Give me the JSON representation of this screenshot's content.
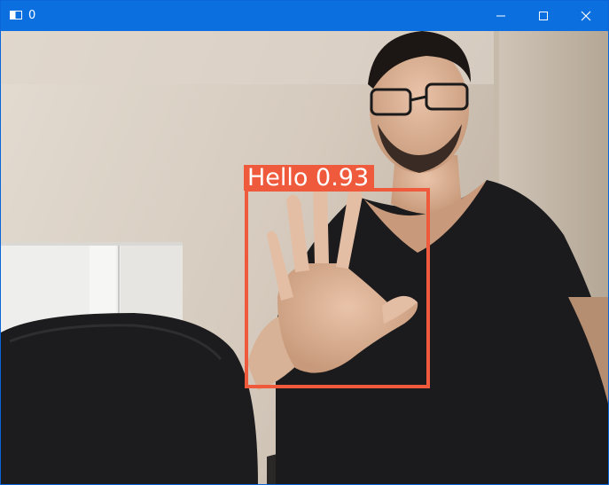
{
  "window": {
    "title": "0",
    "controls": {
      "minimize_icon": "minimize-icon",
      "maximize_icon": "maximize-icon",
      "close_icon": "close-icon"
    },
    "titlebar_color": "#0b6fe0"
  },
  "detection": {
    "label": "Hello",
    "confidence": "0.93",
    "box_color": "#ef5a3d"
  }
}
